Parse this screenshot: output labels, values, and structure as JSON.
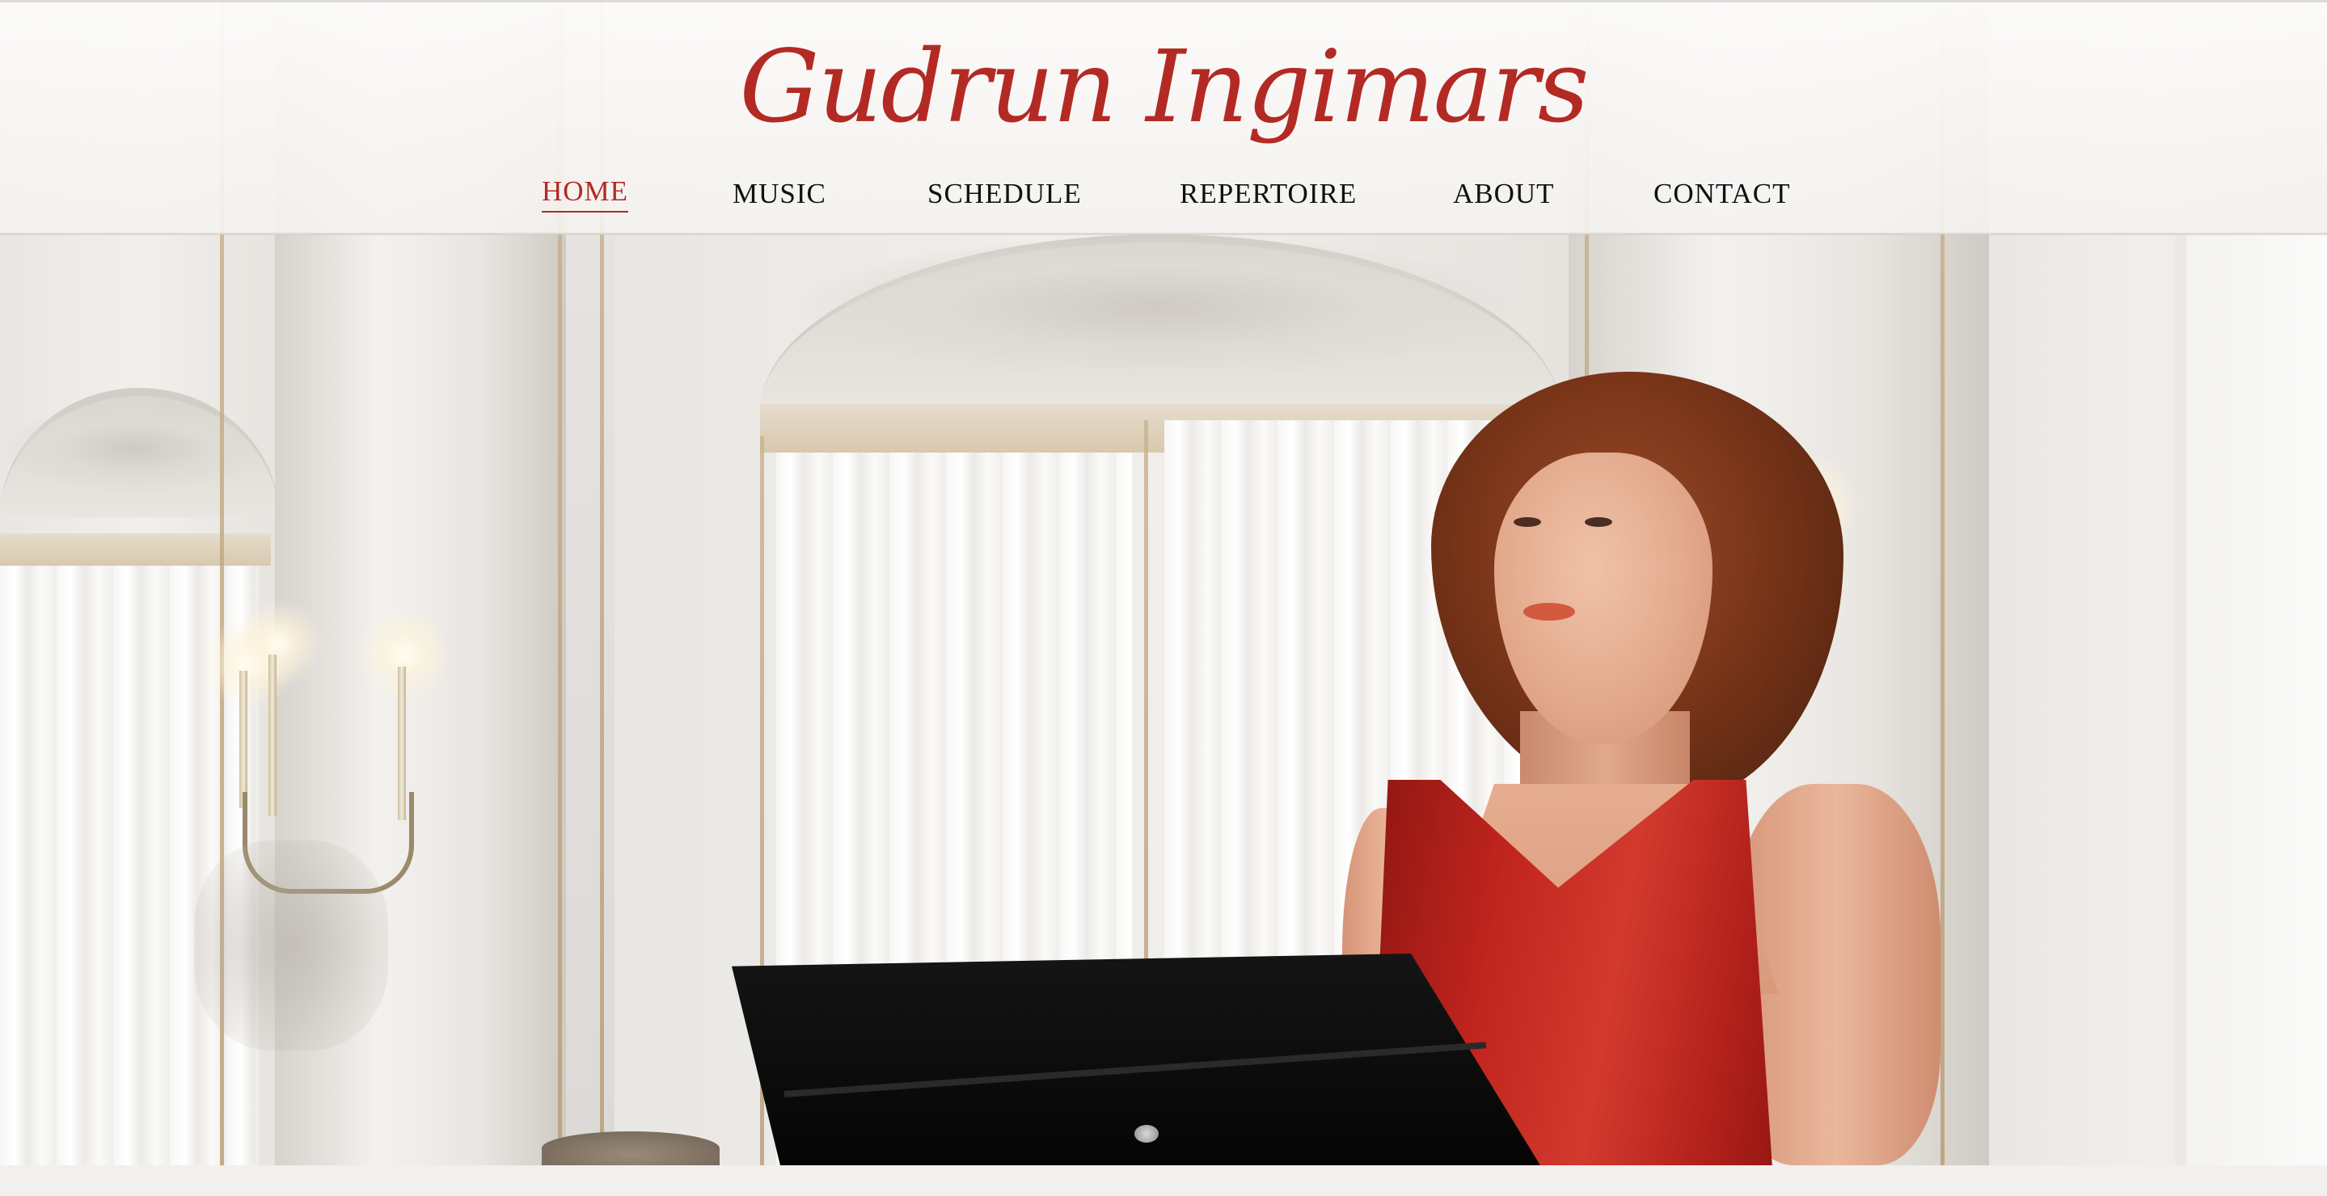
{
  "site": {
    "logo_text": "Gudrun Ingimars",
    "accent_color": "#b32a24",
    "text_color": "#111111"
  },
  "nav": {
    "items": [
      {
        "label": "HOME",
        "active": true
      },
      {
        "label": "MUSIC",
        "active": false
      },
      {
        "label": "SCHEDULE",
        "active": false
      },
      {
        "label": "REPERTOIRE",
        "active": false
      },
      {
        "label": "ABOUT",
        "active": false
      },
      {
        "label": "CONTACT",
        "active": false
      }
    ]
  },
  "hero": {
    "image": "hero-photo",
    "dress_color": "#c1251e"
  }
}
